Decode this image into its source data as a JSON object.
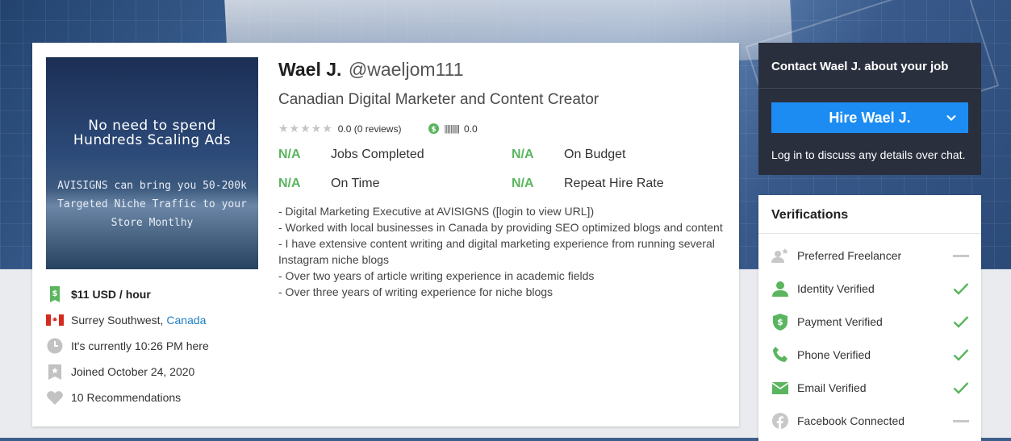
{
  "profile": {
    "name": "Wael J.",
    "handle": "@waeljom111",
    "tagline": "Canadian Digital Marketer and Content Creator",
    "rating_text": "0.0 (0 reviews)",
    "earnings_score": "0.0",
    "avatar_ad": {
      "headline": "No need to spend Hundreds Scaling Ads",
      "subtext": "AVISIGNS can bring you 50-200k Targeted Niche Traffic to your Store Montlhy"
    }
  },
  "stats": [
    {
      "value": "N/A",
      "label": "Jobs Completed"
    },
    {
      "value": "N/A",
      "label": "On Budget"
    },
    {
      "value": "N/A",
      "label": "On Time"
    },
    {
      "value": "N/A",
      "label": "Repeat Hire Rate"
    }
  ],
  "bio": [
    "- Digital Marketing Executive at AVISIGNS ([login to view URL])",
    "- Worked with local businesses in Canada by providing SEO optimized blogs and content",
    "- I have extensive content writing and digital marketing experience from running several Instagram niche blogs",
    "- Over two years of article writing experience in academic fields",
    "- Over three years of writing experience for niche blogs"
  ],
  "details": {
    "rate": "$11 USD / hour",
    "location_city": "Surrey Southwest, ",
    "location_country": "Canada",
    "local_time": "It's currently 10:26 PM here",
    "joined": "Joined October 24, 2020",
    "recommendations": "10 Recommendations"
  },
  "contact": {
    "title": "Contact Wael J. about your job",
    "hire_button": "Hire Wael J.",
    "note": "Log in to discuss any details over chat."
  },
  "verifications": {
    "title": "Verifications",
    "items": [
      {
        "label": "Preferred Freelancer",
        "verified": false,
        "icon": "preferred-freelancer-icon"
      },
      {
        "label": "Identity Verified",
        "verified": true,
        "icon": "user-icon"
      },
      {
        "label": "Payment Verified",
        "verified": true,
        "icon": "shield-dollar-icon"
      },
      {
        "label": "Phone Verified",
        "verified": true,
        "icon": "phone-icon"
      },
      {
        "label": "Email Verified",
        "verified": true,
        "icon": "envelope-icon"
      },
      {
        "label": "Facebook Connected",
        "verified": false,
        "icon": "facebook-icon"
      }
    ]
  },
  "colors": {
    "accent_blue": "#1c8cf2",
    "verified_green": "#5ab55e",
    "dark_panel": "#2a2f3d"
  }
}
